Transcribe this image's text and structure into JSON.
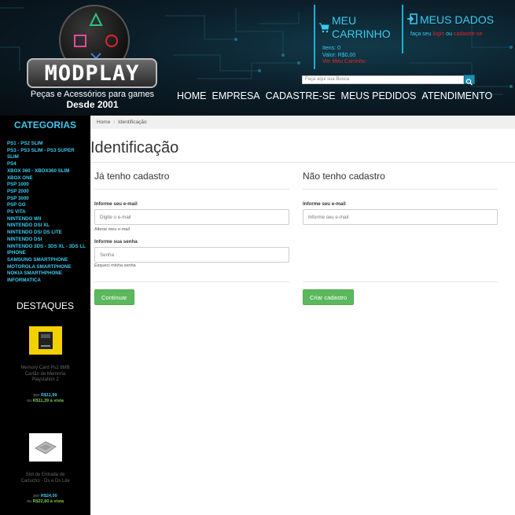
{
  "brand": {
    "logo_text": "MODPLAY",
    "tagline": "Peças e Acessórios para games",
    "since": "Desde 2001"
  },
  "cart": {
    "title_line1": "MEU",
    "title_line2": "CARRINHO",
    "items": "Itens: 0",
    "value": "Valor: R$0,00",
    "view_link": "Ver Meu Carrinho"
  },
  "account": {
    "title": "MEUS DADOS",
    "prefix": "faça seu",
    "login": "login",
    "or": "ou",
    "register": "cadastre-se"
  },
  "search": {
    "placeholder": "Faça aqui sua Busca"
  },
  "nav": [
    "HOME",
    "EMPRESA",
    "CADASTRE-SE",
    "MEUS PEDIDOS",
    "ATENDIMENTO"
  ],
  "sidebar": {
    "categories_title": "CATEGORIAS",
    "categories": [
      "PS1 - PS2 SLIM",
      "PS3 - PS3 SLIM - PS3 SUPER SLIM",
      "PS4",
      "XBOX 360 - XBOX360 SLIM",
      "XBOX ONE",
      "PSP 1000",
      "PSP 2000",
      "PSP 3000",
      "PSP GO",
      "PS VITA",
      "NINTENDO WII",
      "NINTENDO DSI XL",
      "NINTENDO DS/ DS LITE",
      "NINTENDO DSI",
      "NINTENDO 3DS - 3DS XL - 3DS LL",
      "IPHONE",
      "SAMSUNG SMARTPHONE",
      "MOTOROLA SMARTPHONE",
      "NOKIA SMARTHPHONE",
      "INFORMATICA"
    ],
    "highlights_title": "DESTAQUES",
    "products": [
      {
        "name": "Memory Card Ps2 8MB Cartão de Memoria Playstation 2",
        "price_prefix": "por",
        "price": "R$11,99",
        "cash_prefix": "ou",
        "cash_price": "R$11,39 à vista"
      },
      {
        "name": "Slot de Entrada de Cartucho - Ds e Ds Lite",
        "price_prefix": "por",
        "price": "R$24,00",
        "cash_prefix": "ou",
        "cash_price": "R$22,80 à vista"
      }
    ]
  },
  "breadcrumb": {
    "home": "Home",
    "current": "Identificação"
  },
  "page_title": "Identificação",
  "login_form": {
    "title": "Já tenho cadastro",
    "email_label": "Informe seu e-mail",
    "email_placeholder": "Digite o e-mail",
    "email_help": "Alterar meu e-mail",
    "password_label": "Informe sua senha",
    "password_placeholder": "Senha",
    "password_help": "Esqueci minha senha",
    "submit": "Continuar"
  },
  "register_form": {
    "title": "Não tenho cadastro",
    "email_label": "Informe seu e-mail",
    "email_placeholder": "Informe seu e-mail",
    "submit": "Criar cadastro"
  },
  "colors": {
    "accent": "#3cc9ee",
    "link_red": "#e0272b",
    "button_green": "#5cb85c",
    "sidebar_bg": "#000000"
  }
}
